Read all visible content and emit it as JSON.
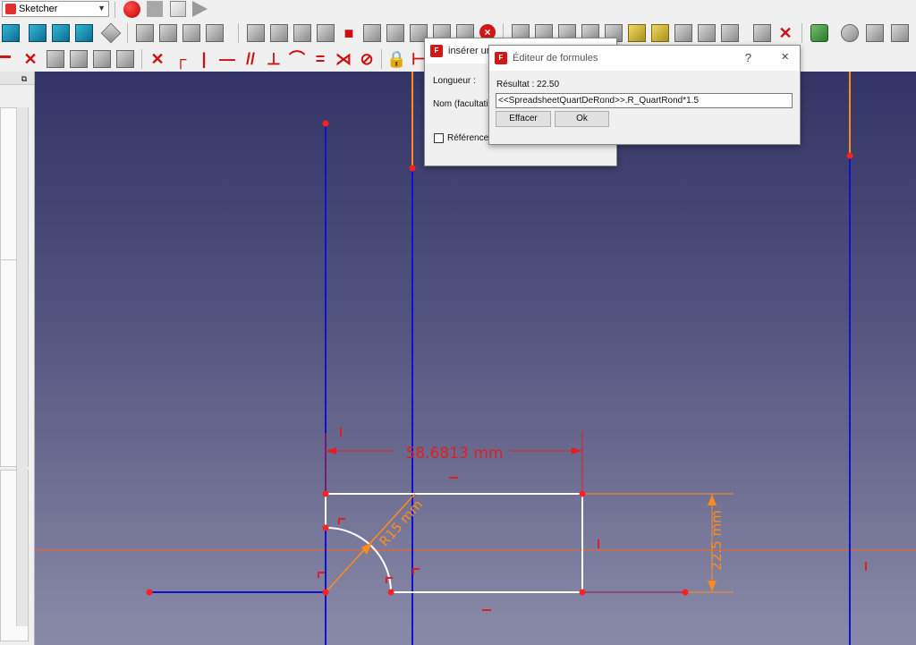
{
  "toolbar": {
    "workbench_selector": {
      "value": "Sketcher"
    }
  },
  "dialog_insert": {
    "title": "insérer une",
    "length_label": "Longueur :",
    "name_label": "Nom (facultatif)",
    "reference_label": "Référence"
  },
  "dialog_formula": {
    "title": "Éditeur de formules",
    "help_glyph": "?",
    "close_glyph": "×",
    "result_label": "Résultat : 22.50",
    "expression": "<<SpreadsheetQuartDeRond>>.R_QuartRond*1.5",
    "clear_button": "Effacer",
    "ok_button": "Ok"
  },
  "sketch": {
    "dim_horizontal": "58.6813 mm",
    "dim_vertical": "22.5 mm",
    "dim_radius": "R15 mm",
    "colors": {
      "construction_blue": "#1010d0",
      "geometry_white": "#ffffff",
      "point_red": "#ff2020",
      "dimension_red": "#e02020",
      "dimension_orange": "#ff8c1a",
      "axis_orange": "#ff6020"
    }
  }
}
